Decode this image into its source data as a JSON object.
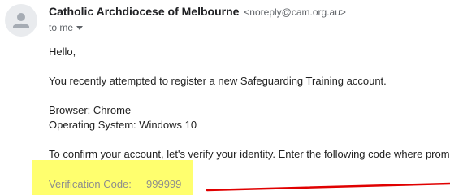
{
  "sender": {
    "name": "Catholic Archdiocese of Melbourne",
    "email": "<noreply@cam.org.au>",
    "avatar_icon": "person-icon"
  },
  "recipient": {
    "label": "to me",
    "expand_icon": "caret-down-icon"
  },
  "body": {
    "greeting": "Hello,",
    "intro": "You recently attempted to register a new Safeguarding Training account.",
    "browser": "Browser: Chrome",
    "os": "Operating System: Windows 10",
    "instruction": "To confirm your account, let's verify your identity. Enter the following code where prompted",
    "code_label": "Verification Code:",
    "code_value": "999999"
  },
  "colors": {
    "highlight": "#ffff6e",
    "annotation_line": "#e00000"
  }
}
